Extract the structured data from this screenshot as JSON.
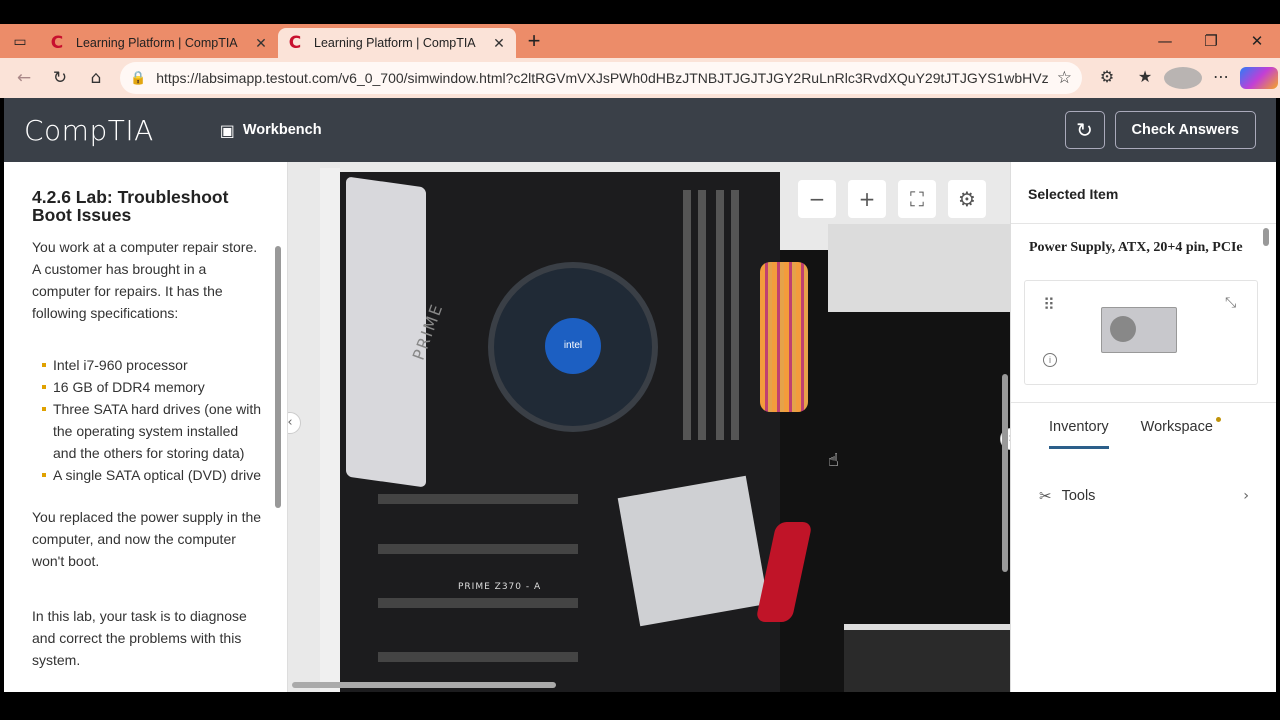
{
  "browser": {
    "tabs": [
      {
        "title": "Learning Platform | CompTIA",
        "active": false
      },
      {
        "title": "Learning Platform | CompTIA",
        "active": true
      }
    ],
    "url": "https://labsimapp.testout.com/v6_0_700/simwindow.html?c2ltRGVmVXJsPWh0dHBzJTNBJTJGJTJGY2RuLnRlc3RvdXQuY29tJTJGYS1wbHVzLTIyM..."
  },
  "app": {
    "logo": "CompTIA",
    "workbench_label": "Workbench",
    "check_answers_label": "Check Answers"
  },
  "lab": {
    "title": "4.2.6 Lab: Troubleshoot Boot Issues",
    "intro": "You work at a computer repair store. A customer has brought in a computer for repairs. It has the following specifications:",
    "specs": [
      "Intel i7-960 processor",
      "16 GB of DDR4 memory",
      "Three SATA hard drives (one with the operating system installed and the others for storing data)",
      "A single SATA optical (DVD) drive"
    ],
    "problem": "You replaced the power supply in the computer, and now the computer won't boot.",
    "task": "In this lab, your task is to diagnose and correct the problems with this system."
  },
  "workspace_view": {
    "board_label": "PRIME Z370 - A",
    "board_side_label": "PRIME",
    "cpu_brand": "intel"
  },
  "selected_item": {
    "header": "Selected Item",
    "name": "Power Supply, ATX, 20+4 pin, PCIe"
  },
  "right_tabs": [
    {
      "label": "Inventory",
      "active": true
    },
    {
      "label": "Workspace",
      "active": false,
      "has_notification": true
    }
  ],
  "tools_label": "Tools",
  "colors": {
    "tab_strip": "#ec8c69",
    "app_header": "#3a4048",
    "bullet": "#e0a100",
    "active_tab_underline": "#2c5f8a"
  }
}
